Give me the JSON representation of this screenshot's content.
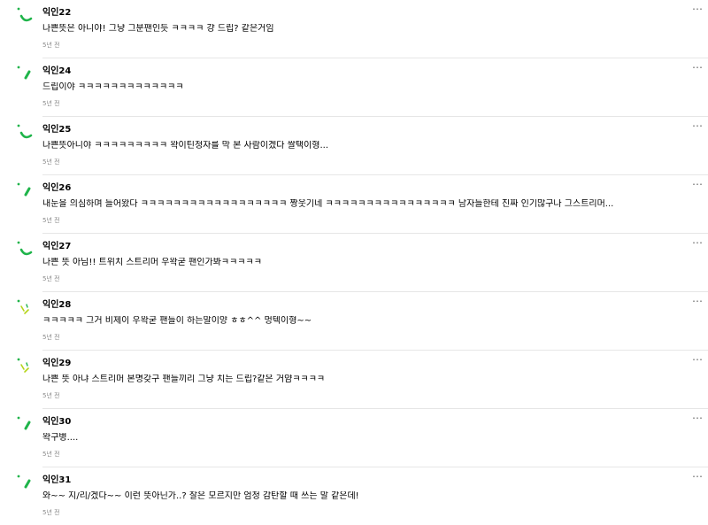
{
  "comments": [
    {
      "nickname": "익인22",
      "text": "나쁜뜻은 아니야! 그냥 그분팬인듯 ㅋㅋㅋㅋ 걍 드립? 같은거임",
      "time": "5년 전",
      "avatar": "green-swoosh"
    },
    {
      "nickname": "익인24",
      "text": "드립이야 ㅋㅋㅋㅋㅋㅋㅋㅋㅋㅋㅋㅋㅋ",
      "time": "5년 전",
      "avatar": "green-slash"
    },
    {
      "nickname": "익인25",
      "text": "나쁜뜻아니야 ㅋㅋㅋㅋㅋㅋㅋㅋㅋ 왁이틴청자를 막 본 사람이겠다 쌀택이형...",
      "time": "5년 전",
      "avatar": "green-swoosh"
    },
    {
      "nickname": "익인26",
      "text": "내눈을 의심하며 들어왔다 ㅋㅋㅋㅋㅋㅋㅋㅋㅋㅋㅋㅋㅋㅋㅋㅋㅋㅋ 짱웃기네 ㅋㅋㅋㅋㅋㅋㅋㅋㅋㅋㅋㅋㅋㅋㅋㅋ 남자들한테 진짜 인기많구나 그스트리머...",
      "time": "5년 전",
      "avatar": "green-slash"
    },
    {
      "nickname": "익인27",
      "text": "나쁜 뜻 아님!! 트위치 스트리머 우왁굳 팬인가봐ㅋㅋㅋㅋㅋ",
      "time": "5년 전",
      "avatar": "green-swoosh"
    },
    {
      "nickname": "익인28",
      "text": "ㅋㅋㅋㅋㅋ 그거 비제이 우왁굳 팬들이 하는말이양 ㅎㅎ^^ 멍텍이형~~",
      "time": "5년 전",
      "avatar": "lime-sparkle"
    },
    {
      "nickname": "익인29",
      "text": "나쁜 뜻 아냐 스트리머 본명갖구 팬들끼리 그냥 치는 드립?같은 거얌ㅋㅋㅋㅋ",
      "time": "5년 전",
      "avatar": "lime-sparkle"
    },
    {
      "nickname": "익인30",
      "text": "왁구병....",
      "time": "5년 전",
      "avatar": "green-slash"
    },
    {
      "nickname": "익인31",
      "text": "와~~ 지/리/겠다~~ 이런 뜻아닌가..? 잘은 모르지만 엄청 감탄할 때 쓰는 말 같은데!",
      "time": "5년 전",
      "avatar": "green-slash"
    }
  ],
  "more_icon": "⋯",
  "colors": {
    "green": "#1fb44a",
    "lime": "#b5d419",
    "time": "#8a8a8a",
    "divider": "#e6e6e6"
  }
}
